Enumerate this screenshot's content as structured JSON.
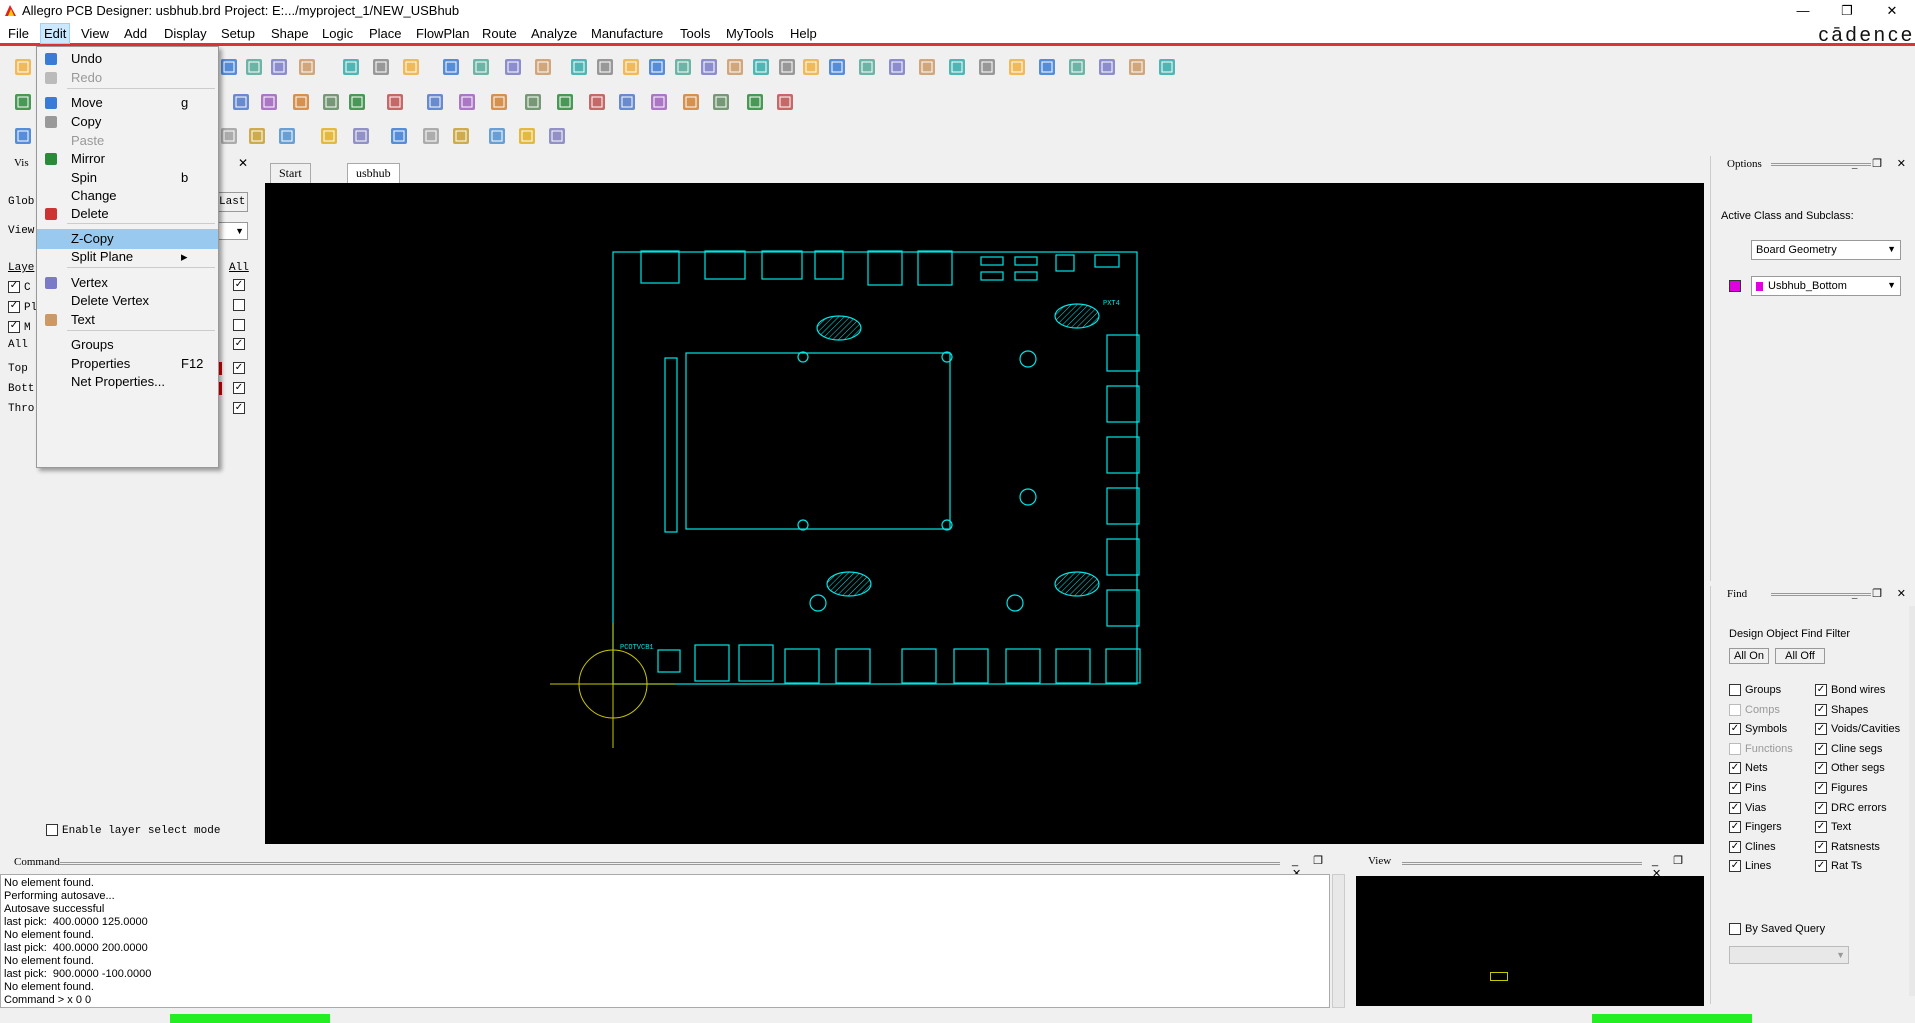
{
  "window": {
    "title": "Allegro PCB Designer: usbhub.brd  Project: E:.../myproject_1/NEW_USBhub",
    "minimize": "—",
    "restore": "❐",
    "close": "✕",
    "brand": "cādence"
  },
  "menubar": [
    "File",
    "Edit",
    "View",
    "Add",
    "Display",
    "Setup",
    "Shape",
    "Logic",
    "Place",
    "FlowPlan",
    "Route",
    "Analyze",
    "Manufacture",
    "Tools",
    "MyTools",
    "Help"
  ],
  "edit_menu": {
    "items": [
      {
        "label": "Undo",
        "shortcut": "",
        "icon": "undo-icon",
        "disabled": false
      },
      {
        "label": "Redo",
        "shortcut": "",
        "icon": "redo-icon",
        "disabled": true
      },
      {
        "label": "Move",
        "shortcut": "g",
        "icon": "move-icon",
        "disabled": false
      },
      {
        "label": "Copy",
        "shortcut": "",
        "icon": "copy-icon",
        "disabled": false
      },
      {
        "label": "Paste",
        "shortcut": "",
        "icon": "",
        "disabled": true
      },
      {
        "label": "Mirror",
        "shortcut": "",
        "icon": "mirror-icon",
        "disabled": false
      },
      {
        "label": "Spin",
        "shortcut": "b",
        "icon": "",
        "disabled": false
      },
      {
        "label": "Change",
        "shortcut": "",
        "icon": "",
        "disabled": false
      },
      {
        "label": "Delete",
        "shortcut": "",
        "icon": "delete-icon",
        "disabled": false
      },
      {
        "label": "Z-Copy",
        "shortcut": "",
        "icon": "",
        "disabled": false,
        "highlighted": true
      },
      {
        "label": "Split Plane",
        "shortcut": "▸",
        "icon": "",
        "disabled": false
      },
      {
        "label": "Vertex",
        "shortcut": "",
        "icon": "vertex-icon",
        "disabled": false
      },
      {
        "label": "Delete Vertex",
        "shortcut": "",
        "icon": "",
        "disabled": false
      },
      {
        "label": "Text",
        "shortcut": "",
        "icon": "text-icon",
        "disabled": false
      },
      {
        "label": "Groups",
        "shortcut": "",
        "icon": "",
        "disabled": false
      },
      {
        "label": "Properties",
        "shortcut": "F12",
        "icon": "",
        "disabled": false
      },
      {
        "label": "Net Properties...",
        "shortcut": "",
        "icon": "",
        "disabled": false
      }
    ]
  },
  "visibility_panel": {
    "title": "Vis",
    "global_label": "Glob",
    "last_button": "Last",
    "view_label": "View",
    "layer_label": "Laye",
    "all_header": "All",
    "rows": [
      "C",
      "Pl",
      "M",
      "All"
    ],
    "layers": [
      "Top",
      "Bott",
      "Thro"
    ],
    "enable_layer_select": "Enable layer select mode"
  },
  "tabs": [
    "Start Page",
    "usbhub"
  ],
  "options": {
    "title": "Options",
    "active_class_label": "Active Class and Subclass:",
    "class_value": "Board Geometry",
    "subclass_value": "Usbhub_Bottom",
    "subclass_color": "#e000e0"
  },
  "find": {
    "title": "Find",
    "filter_title": "Design Object Find Filter",
    "all_on": "All On",
    "all_off": "All Off",
    "left": [
      {
        "label": "Groups",
        "checked": false,
        "disabled": false
      },
      {
        "label": "Comps",
        "checked": false,
        "disabled": true
      },
      {
        "label": "Symbols",
        "checked": true,
        "disabled": false
      },
      {
        "label": "Functions",
        "checked": false,
        "disabled": true
      },
      {
        "label": "Nets",
        "checked": true,
        "disabled": false
      },
      {
        "label": "Pins",
        "checked": true,
        "disabled": false
      },
      {
        "label": "Vias",
        "checked": true,
        "disabled": false
      },
      {
        "label": "Fingers",
        "checked": true,
        "disabled": false
      },
      {
        "label": "Clines",
        "checked": true,
        "disabled": false
      },
      {
        "label": "Lines",
        "checked": true,
        "disabled": false
      }
    ],
    "right": [
      {
        "label": "Bond wires",
        "checked": true
      },
      {
        "label": "Shapes",
        "checked": true
      },
      {
        "label": "Voids/Cavities",
        "checked": true
      },
      {
        "label": "Cline segs",
        "checked": true
      },
      {
        "label": "Other segs",
        "checked": true
      },
      {
        "label": "Figures",
        "checked": true
      },
      {
        "label": "DRC errors",
        "checked": true
      },
      {
        "label": "Text",
        "checked": true
      },
      {
        "label": "Ratsnests",
        "checked": true
      },
      {
        "label": "Rat Ts",
        "checked": true
      }
    ],
    "by_saved_query": "By Saved Query"
  },
  "command": {
    "title": "Command",
    "log": "No element found.\nPerforming autosave...\nAutosave successful\nlast pick:  400.0000 125.0000\nNo element found.\nlast pick:  400.0000 200.0000\nNo element found.\nlast pick:  900.0000 -100.0000\nNo element found.\nCommand > x 0 0"
  },
  "view_pane": {
    "title": "View"
  },
  "board": {
    "outline_color": "#00e5e5",
    "crosshair_color": "#c8c800",
    "labels": {
      "pxt": "PXT4",
      "ref1": "PCOTVCB1"
    }
  }
}
